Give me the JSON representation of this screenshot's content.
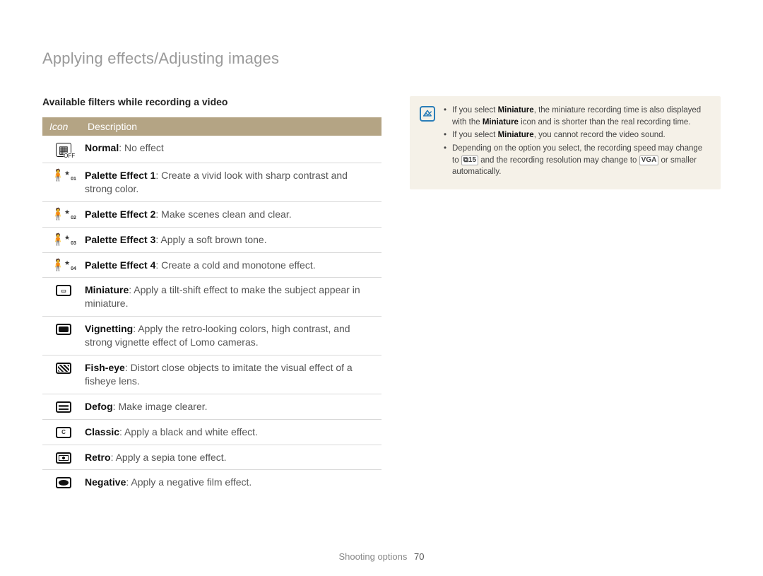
{
  "page_title": "Applying effects/Adjusting images",
  "section_heading": "Available filters while recording a video",
  "table": {
    "header_icon": "Icon",
    "header_desc": "Description",
    "rows": [
      {
        "icon_name": "normal-off-icon",
        "label": "Normal",
        "text": ": No effect"
      },
      {
        "icon_name": "palette-1-icon",
        "label": "Palette Effect 1",
        "text": ": Create a vivid look with sharp contrast and strong color."
      },
      {
        "icon_name": "palette-2-icon",
        "label": "Palette Effect 2",
        "text": ": Make scenes clean and clear."
      },
      {
        "icon_name": "palette-3-icon",
        "label": "Palette Effect 3",
        "text": ": Apply a soft brown tone."
      },
      {
        "icon_name": "palette-4-icon",
        "label": "Palette Effect 4",
        "text": ": Create a cold and monotone effect."
      },
      {
        "icon_name": "miniature-icon",
        "label": "Miniature",
        "text": ": Apply a tilt-shift effect to make the subject appear in miniature."
      },
      {
        "icon_name": "vignetting-icon",
        "label": "Vignetting",
        "text": ": Apply the retro-looking colors, high contrast, and strong vignette effect of Lomo cameras."
      },
      {
        "icon_name": "fisheye-icon",
        "label": "Fish-eye",
        "text": ": Distort close objects to imitate the visual effect of a fisheye lens."
      },
      {
        "icon_name": "defog-icon",
        "label": "Defog",
        "text": ": Make image clearer."
      },
      {
        "icon_name": "classic-icon",
        "label": "Classic",
        "text": ": Apply a black and white effect."
      },
      {
        "icon_name": "retro-icon",
        "label": "Retro",
        "text": ": Apply a sepia tone effect."
      },
      {
        "icon_name": "negative-icon",
        "label": "Negative",
        "text": ": Apply a negative film effect."
      }
    ]
  },
  "info": {
    "items": [
      {
        "pre": "If you select ",
        "b1": "Miniature",
        "mid1": ", the miniature recording time is also displayed with the ",
        "b2": "Miniature",
        "mid2": " icon and is shorter than the real recording time."
      },
      {
        "pre": "If you select ",
        "b1": "Miniature",
        "mid1": ", you cannot record the video sound.",
        "b2": "",
        "mid2": ""
      },
      {
        "pre": "Depending on the option you select, the recording speed may change to ",
        "icon1": "rec-speed-icon",
        "mid1": " and the recording resolution may change to ",
        "icon2": "vga-icon",
        "icon2_text": "VGA",
        "mid2": " or smaller automatically.",
        "b1": "",
        "b2": ""
      }
    ]
  },
  "footer_section": "Shooting options",
  "footer_page": "70"
}
